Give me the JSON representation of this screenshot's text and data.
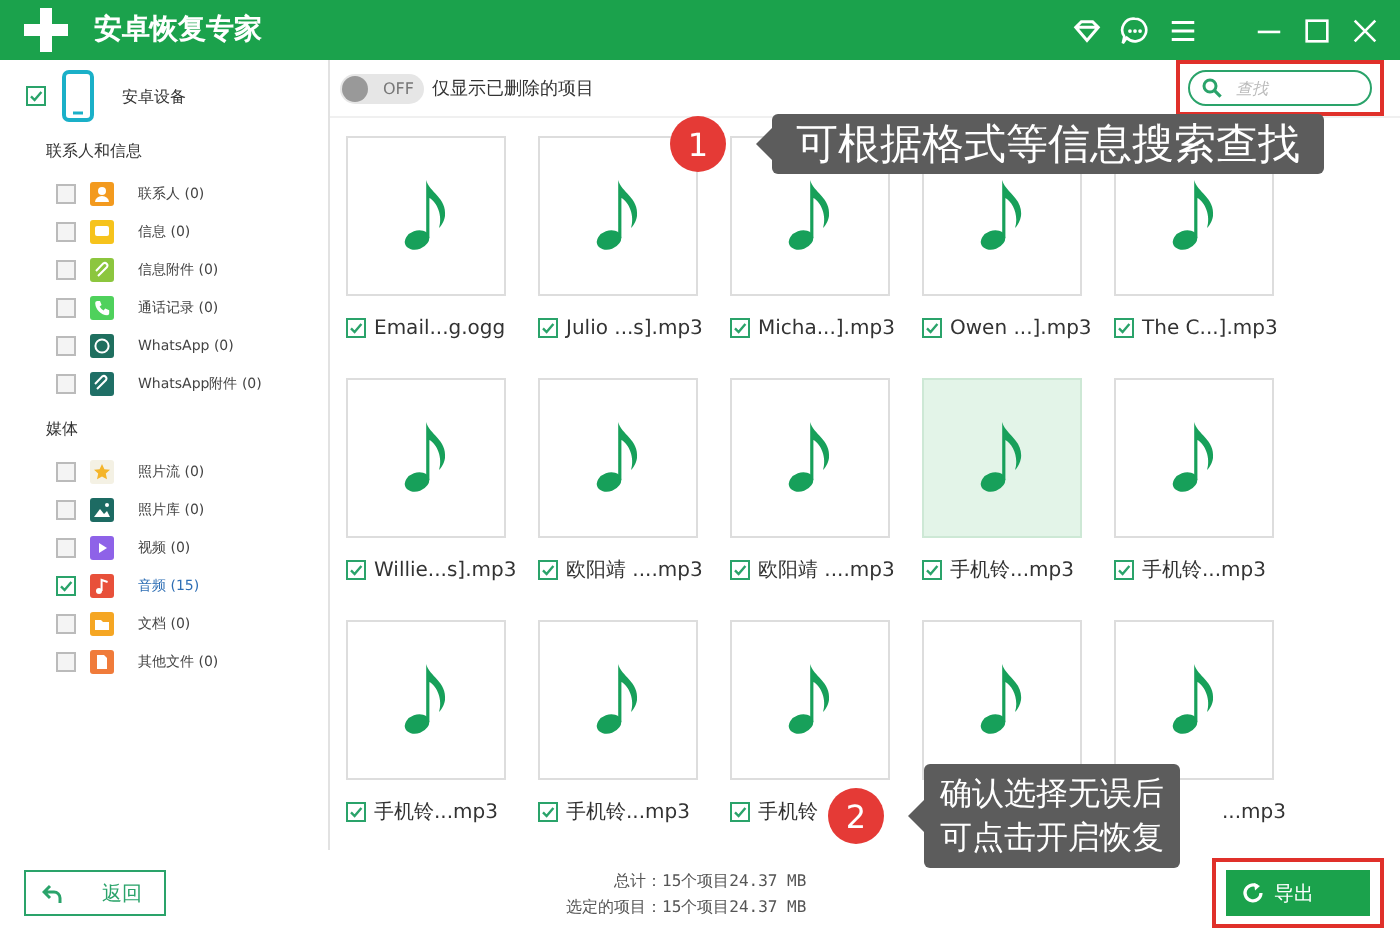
{
  "window": {
    "title": "安卓恢复专家"
  },
  "sidebar": {
    "device": {
      "label": "安卓设备",
      "checked": true
    },
    "sections": [
      {
        "title": "联系人和信息",
        "items": [
          {
            "kind": "contacts",
            "label": "联系人 (0)",
            "checked": false,
            "color": "#f39a1e"
          },
          {
            "kind": "messages",
            "label": "信息 (0)",
            "checked": false,
            "color": "#f6c31c"
          },
          {
            "kind": "attachments",
            "label": "信息附件 (0)",
            "checked": false,
            "color": "#8cc63e"
          },
          {
            "kind": "calls",
            "label": "通话记录 (0)",
            "checked": false,
            "color": "#4fd15c"
          },
          {
            "kind": "whatsapp",
            "label": "WhatsApp (0)",
            "checked": false,
            "color": "#1f6f5f"
          },
          {
            "kind": "whatsapp-attachments",
            "label": "WhatsApp附件 (0)",
            "checked": false,
            "color": "#1f6f66"
          }
        ]
      },
      {
        "title": "媒体",
        "items": [
          {
            "kind": "photostream",
            "label": "照片流 (0)",
            "checked": false,
            "color": "#f4f1e4"
          },
          {
            "kind": "photos",
            "label": "照片库 (0)",
            "checked": false,
            "color": "#1d6b63"
          },
          {
            "kind": "video",
            "label": "视频 (0)",
            "checked": false,
            "color": "#8e62e8"
          },
          {
            "kind": "audio",
            "label": "音频 (15)",
            "checked": true,
            "color": "#e8503a"
          },
          {
            "kind": "documents",
            "label": "文档 (0)",
            "checked": false,
            "color": "#f5a623"
          },
          {
            "kind": "other",
            "label": "其他文件 (0)",
            "checked": false,
            "color": "#f07b3a"
          }
        ]
      }
    ]
  },
  "toolbar": {
    "toggle": {
      "text": "OFF",
      "on": false
    },
    "label": "仅显示已删除的项目",
    "search": {
      "placeholder": "查找"
    }
  },
  "files": [
    {
      "label": "Email...g.ogg",
      "checked": true,
      "selected": false
    },
    {
      "label": "Julio ...s].mp3",
      "checked": true,
      "selected": false
    },
    {
      "label": "Micha...].mp3",
      "checked": true,
      "selected": false
    },
    {
      "label": "Owen ...].mp3",
      "checked": true,
      "selected": false
    },
    {
      "label": "The C...].mp3",
      "checked": true,
      "selected": false
    },
    {
      "label": "Willie...s].mp3",
      "checked": true,
      "selected": false
    },
    {
      "label": "欧阳靖 ....mp3",
      "checked": true,
      "selected": false
    },
    {
      "label": "欧阳靖 ....mp3",
      "checked": true,
      "selected": false
    },
    {
      "label": "手机铃...mp3",
      "checked": true,
      "selected": true
    },
    {
      "label": "手机铃...mp3",
      "checked": true,
      "selected": false
    },
    {
      "label": "手机铃...mp3",
      "checked": true,
      "selected": false
    },
    {
      "label": "手机铃...mp3",
      "checked": true,
      "selected": false
    },
    {
      "label": "手机铃",
      "checked": true,
      "selected": false
    },
    {
      "selected": false
    },
    {
      "label": "...mp3",
      "selected": false
    }
  ],
  "callouts": [
    {
      "number": "1",
      "lines": [
        "可根据格式等信息搜索查找"
      ]
    },
    {
      "number": "2",
      "lines": [
        "确认选择无误后",
        "可点击开启恢复"
      ]
    }
  ],
  "footer": {
    "back": "返回",
    "total": "总计：15个项目24.37 MB",
    "selected_total": "选定的项目：15个项目24.37 MB",
    "export": "导出"
  }
}
